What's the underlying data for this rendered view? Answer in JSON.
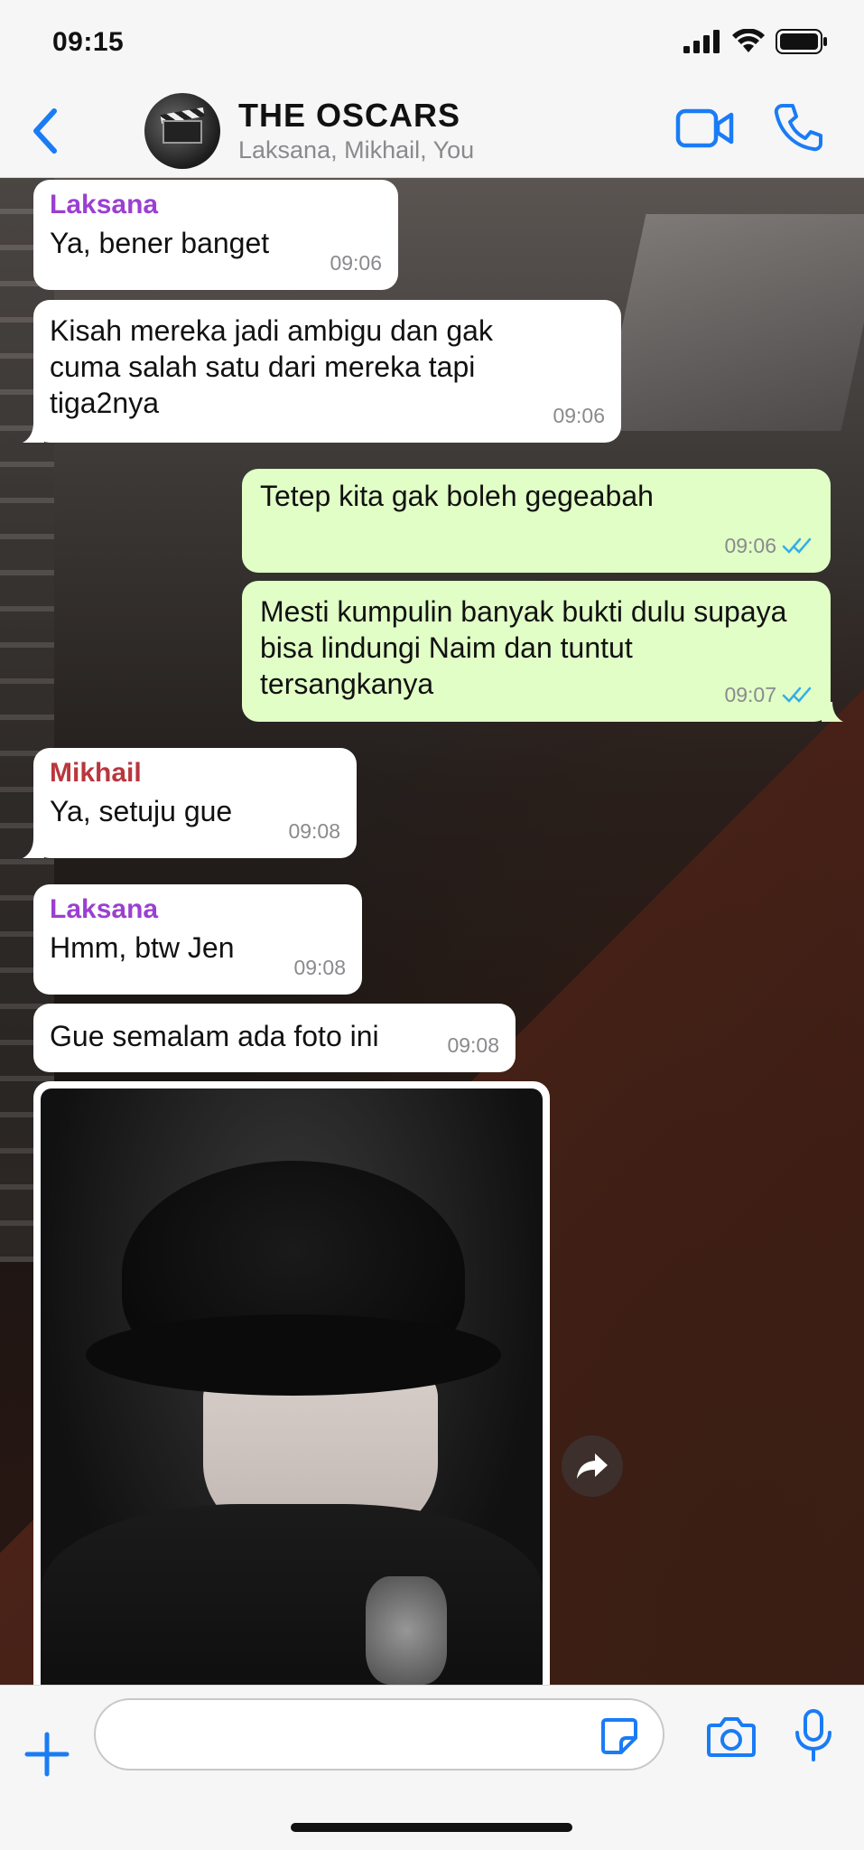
{
  "status_bar": {
    "time": "09:15"
  },
  "header": {
    "title": "THE OSCARS",
    "subtitle": "Laksana, Mikhail, You"
  },
  "messages": [
    {
      "sender": "Laksana",
      "text": "Ya, bener banget",
      "time": "09:06",
      "direction": "in",
      "sender_color": "#9b3fd1"
    },
    {
      "sender": "",
      "text": "Kisah mereka jadi ambigu dan gak cuma salah satu dari mereka tapi tiga2nya",
      "time": "09:06",
      "direction": "in"
    },
    {
      "sender": "",
      "text": "Tetep kita gak boleh gegeabah",
      "time": "09:06",
      "direction": "out",
      "status": "read"
    },
    {
      "sender": "",
      "text": "Mesti kumpulin banyak bukti dulu supaya bisa lindungi Naim dan tuntut tersangkanya",
      "time": "09:07",
      "direction": "out",
      "status": "read"
    },
    {
      "sender": "Mikhail",
      "text": "Ya, setuju gue",
      "time": "09:08",
      "direction": "in",
      "sender_color": "#b8373d"
    },
    {
      "sender": "Laksana",
      "text": "Hmm, btw Jen",
      "time": "09:08",
      "direction": "in",
      "sender_color": "#9b3fd1"
    },
    {
      "sender": "",
      "text": "Gue semalam ada foto ini",
      "time": "09:08",
      "direction": "in"
    }
  ],
  "input": {
    "value": "",
    "placeholder": ""
  },
  "colors": {
    "accent": "#1a7cf5",
    "outgoing_bubble": "#e1fec6",
    "read_tick": "#34aee8"
  }
}
